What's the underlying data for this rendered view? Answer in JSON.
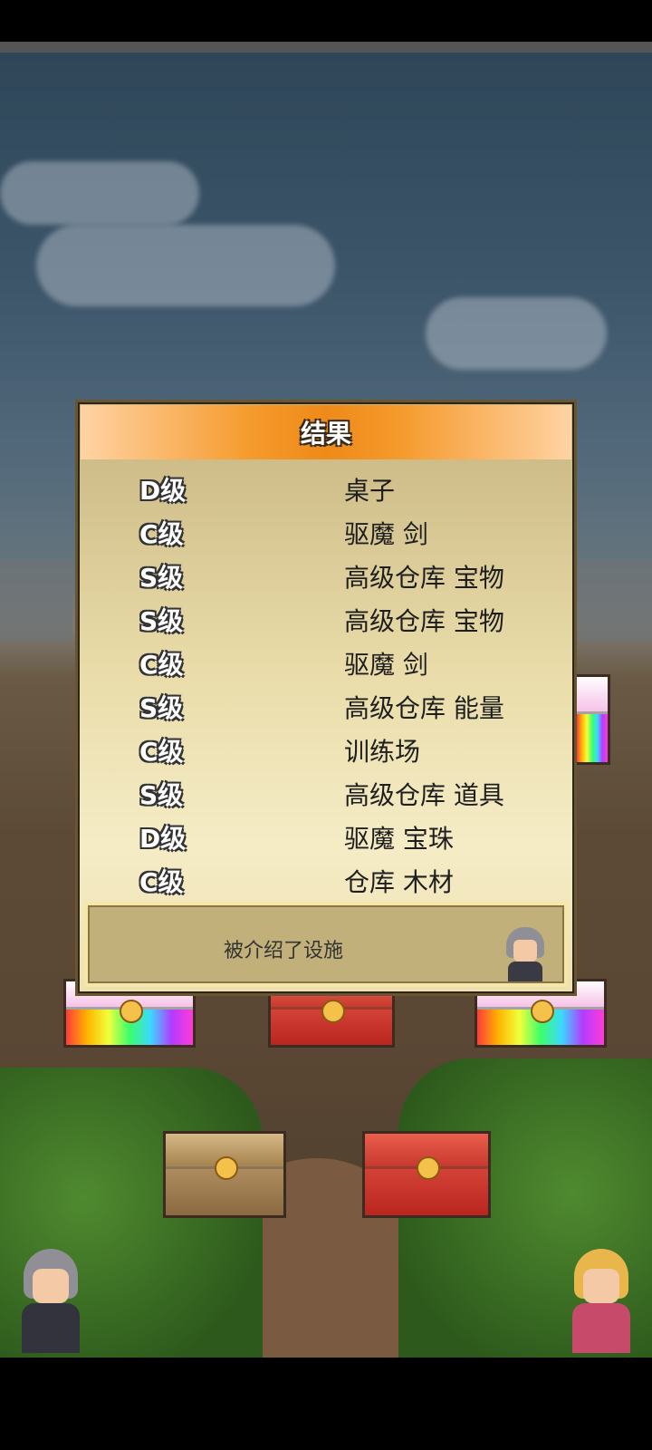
{
  "dialog": {
    "title": "结果",
    "results": [
      {
        "grade": "D级",
        "item": "桌子"
      },
      {
        "grade": "C级",
        "item": "驱魔 剑"
      },
      {
        "grade": "S级",
        "item": "高级仓库 宝物"
      },
      {
        "grade": "S级",
        "item": "高级仓库 宝物"
      },
      {
        "grade": "C级",
        "item": "驱魔 剑"
      },
      {
        "grade": "S级",
        "item": "高级仓库 能量"
      },
      {
        "grade": "C级",
        "item": "训练场"
      },
      {
        "grade": "S级",
        "item": "高级仓库 道具"
      },
      {
        "grade": "D级",
        "item": "驱魔 宝珠"
      },
      {
        "grade": "C级",
        "item": "仓库 木材"
      }
    ],
    "message": "被介绍了设施"
  },
  "colors": {
    "title_bar": "#ee8a18",
    "panel": "#eee0b0",
    "message_box": "#c2b07a"
  },
  "scene": {
    "chests": [
      "rainbow",
      "red",
      "rainbow",
      "wood",
      "red"
    ]
  }
}
